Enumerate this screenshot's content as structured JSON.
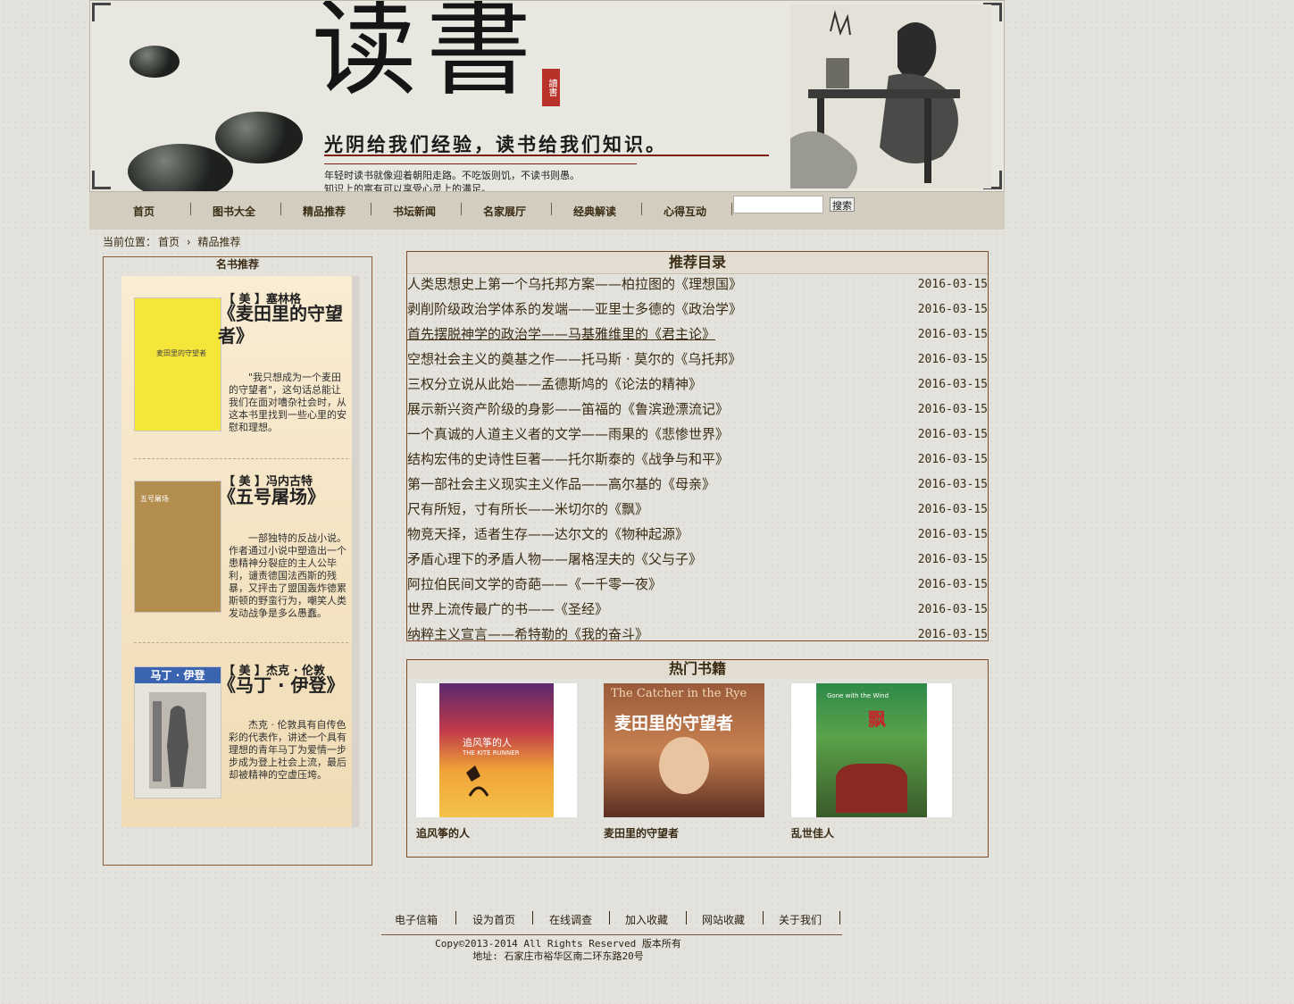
{
  "banner": {
    "title": "读書",
    "seal": "讀書",
    "slogan": "光阴给我们经验，读书给我们知识。",
    "sub_line1": "年轻时读书就像迎着朝阳走路。不吃饭则饥，不读书则愚。",
    "sub_line2": "知识上的富有可以享受心灵上的满足。"
  },
  "nav": {
    "items": [
      "首页",
      "图书大全",
      "精品推荐",
      "书坛新闻",
      "名家展厅",
      "经典解读",
      "心得互动"
    ],
    "search_button": "搜索",
    "search_value": ""
  },
  "breadcrumb": {
    "label": "当前位置：",
    "home": "首页",
    "current": "精品推荐"
  },
  "famous_books": {
    "title": "名书推荐",
    "books": [
      {
        "author": "【 美 】塞林格",
        "title": "《麦田里的守望者》",
        "cover_text": "麦田里的守望者",
        "description": "\"我只想成为一个麦田的守望者\"，这句话总能让我们在面对嘈杂社会时，从这本书里找到一些心里的安慰和理想。",
        "cover_color": "#f6e63a"
      },
      {
        "author": "【 美 】冯内古特",
        "title": "《五号屠场》",
        "cover_text": "五号屠场",
        "description": "一部独特的反战小说。作者通过小说中塑造出一个患精神分裂症的主人公毕利，谴责德国法西斯的残暴，又抨击了盟国轰炸德累斯顿的野蛮行为，嘲笑人类发动战争是多么愚蠢。",
        "cover_color": "#b48e4e"
      },
      {
        "author": "【 美 】杰克 · 伦敦",
        "title": "《马丁 · 伊登》",
        "cover_text": "马丁 · 伊登",
        "description": "杰克 · 伦敦具有自传色彩的代表作，讲述一个具有理想的青年马丁为爱情一步步成为登上社会上流，最后却被精神的空虚压垮。",
        "cover_color": "#3a64b0"
      }
    ]
  },
  "recommended": {
    "title": "推荐目录",
    "items": [
      {
        "text": "人类思想史上第一个乌托邦方案——柏拉图的《理想国》",
        "date": "2016-03-15"
      },
      {
        "text": "剥削阶级政治学体系的发端——亚里士多德的《政治学》",
        "date": "2016-03-15"
      },
      {
        "text": "首先摆脱神学的政治学——马基雅维里的《君主论》",
        "date": "2016-03-15"
      },
      {
        "text": "空想社会主义的奠基之作——托马斯 · 莫尔的《乌托邦》",
        "date": "2016-03-15"
      },
      {
        "text": "三权分立说从此始——孟德斯鸠的《论法的精神》",
        "date": "2016-03-15"
      },
      {
        "text": "展示新兴资产阶级的身影——笛福的《鲁滨逊漂流记》",
        "date": "2016-03-15"
      },
      {
        "text": "一个真诚的人道主义者的文学——雨果的《悲惨世界》",
        "date": "2016-03-15"
      },
      {
        "text": "结构宏伟的史诗性巨著——托尔斯泰的《战争与和平》",
        "date": "2016-03-15"
      },
      {
        "text": "第一部社会主义现实主义作品——高尔基的《母亲》",
        "date": "2016-03-15"
      },
      {
        "text": "尺有所短，寸有所长——米切尔的《飘》",
        "date": "2016-03-15"
      },
      {
        "text": "物竞天择，适者生存——达尔文的《物种起源》",
        "date": "2016-03-15"
      },
      {
        "text": "矛盾心理下的矛盾人物——屠格涅夫的《父与子》",
        "date": "2016-03-15"
      },
      {
        "text": "阿拉伯民间文学的奇葩——《一千零一夜》",
        "date": "2016-03-15"
      },
      {
        "text": "世界上流传最广的书——《圣经》",
        "date": "2016-03-15"
      },
      {
        "text": "纳粹主义宣言——希特勒的《我的奋斗》",
        "date": "2016-03-15"
      }
    ]
  },
  "hot_books": {
    "title": "热门书籍",
    "books": [
      {
        "name": "追风筝的人",
        "cover_title": "追风筝的人",
        "cover_subtitle": "THE KITE RUNNER"
      },
      {
        "name": "麦田里的守望者",
        "cover_title": "麦田里的守望者",
        "cover_subtitle": "The Catcher in the Rye"
      },
      {
        "name": "乱世佳人",
        "cover_title": "飘",
        "cover_subtitle": "Gone with the Wind"
      }
    ]
  },
  "footer": {
    "links": [
      "电子信箱",
      "设为首页",
      "在线调查",
      "加入收藏",
      "网站收藏",
      "关于我们"
    ],
    "copyright": "Copy©2013-2014 All Rights Reserved 版本所有",
    "address": "地址: 石家庄市裕华区南二环东路20号"
  }
}
